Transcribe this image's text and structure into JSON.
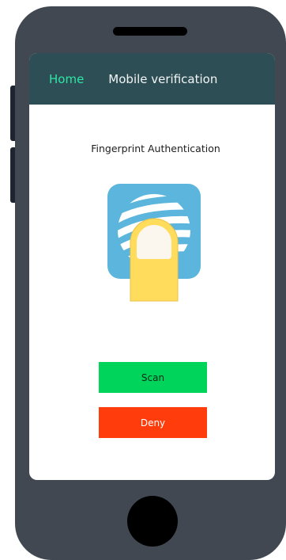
{
  "appbar": {
    "home_label": "Home",
    "title": "Mobile verification"
  },
  "auth": {
    "title": "Fingerprint Authentication",
    "icon": "fingerprint-icon"
  },
  "actions": {
    "scan_label": "Scan",
    "deny_label": "Deny"
  },
  "colors": {
    "appbar_bg": "#2e4e55",
    "home_link": "#2ee6a6",
    "scan_button": "#00d45a",
    "deny_button": "#ff3d0c",
    "icon_tile": "#5bb5dc",
    "finger": "#ffdc5c",
    "phone_body": "#414852"
  }
}
